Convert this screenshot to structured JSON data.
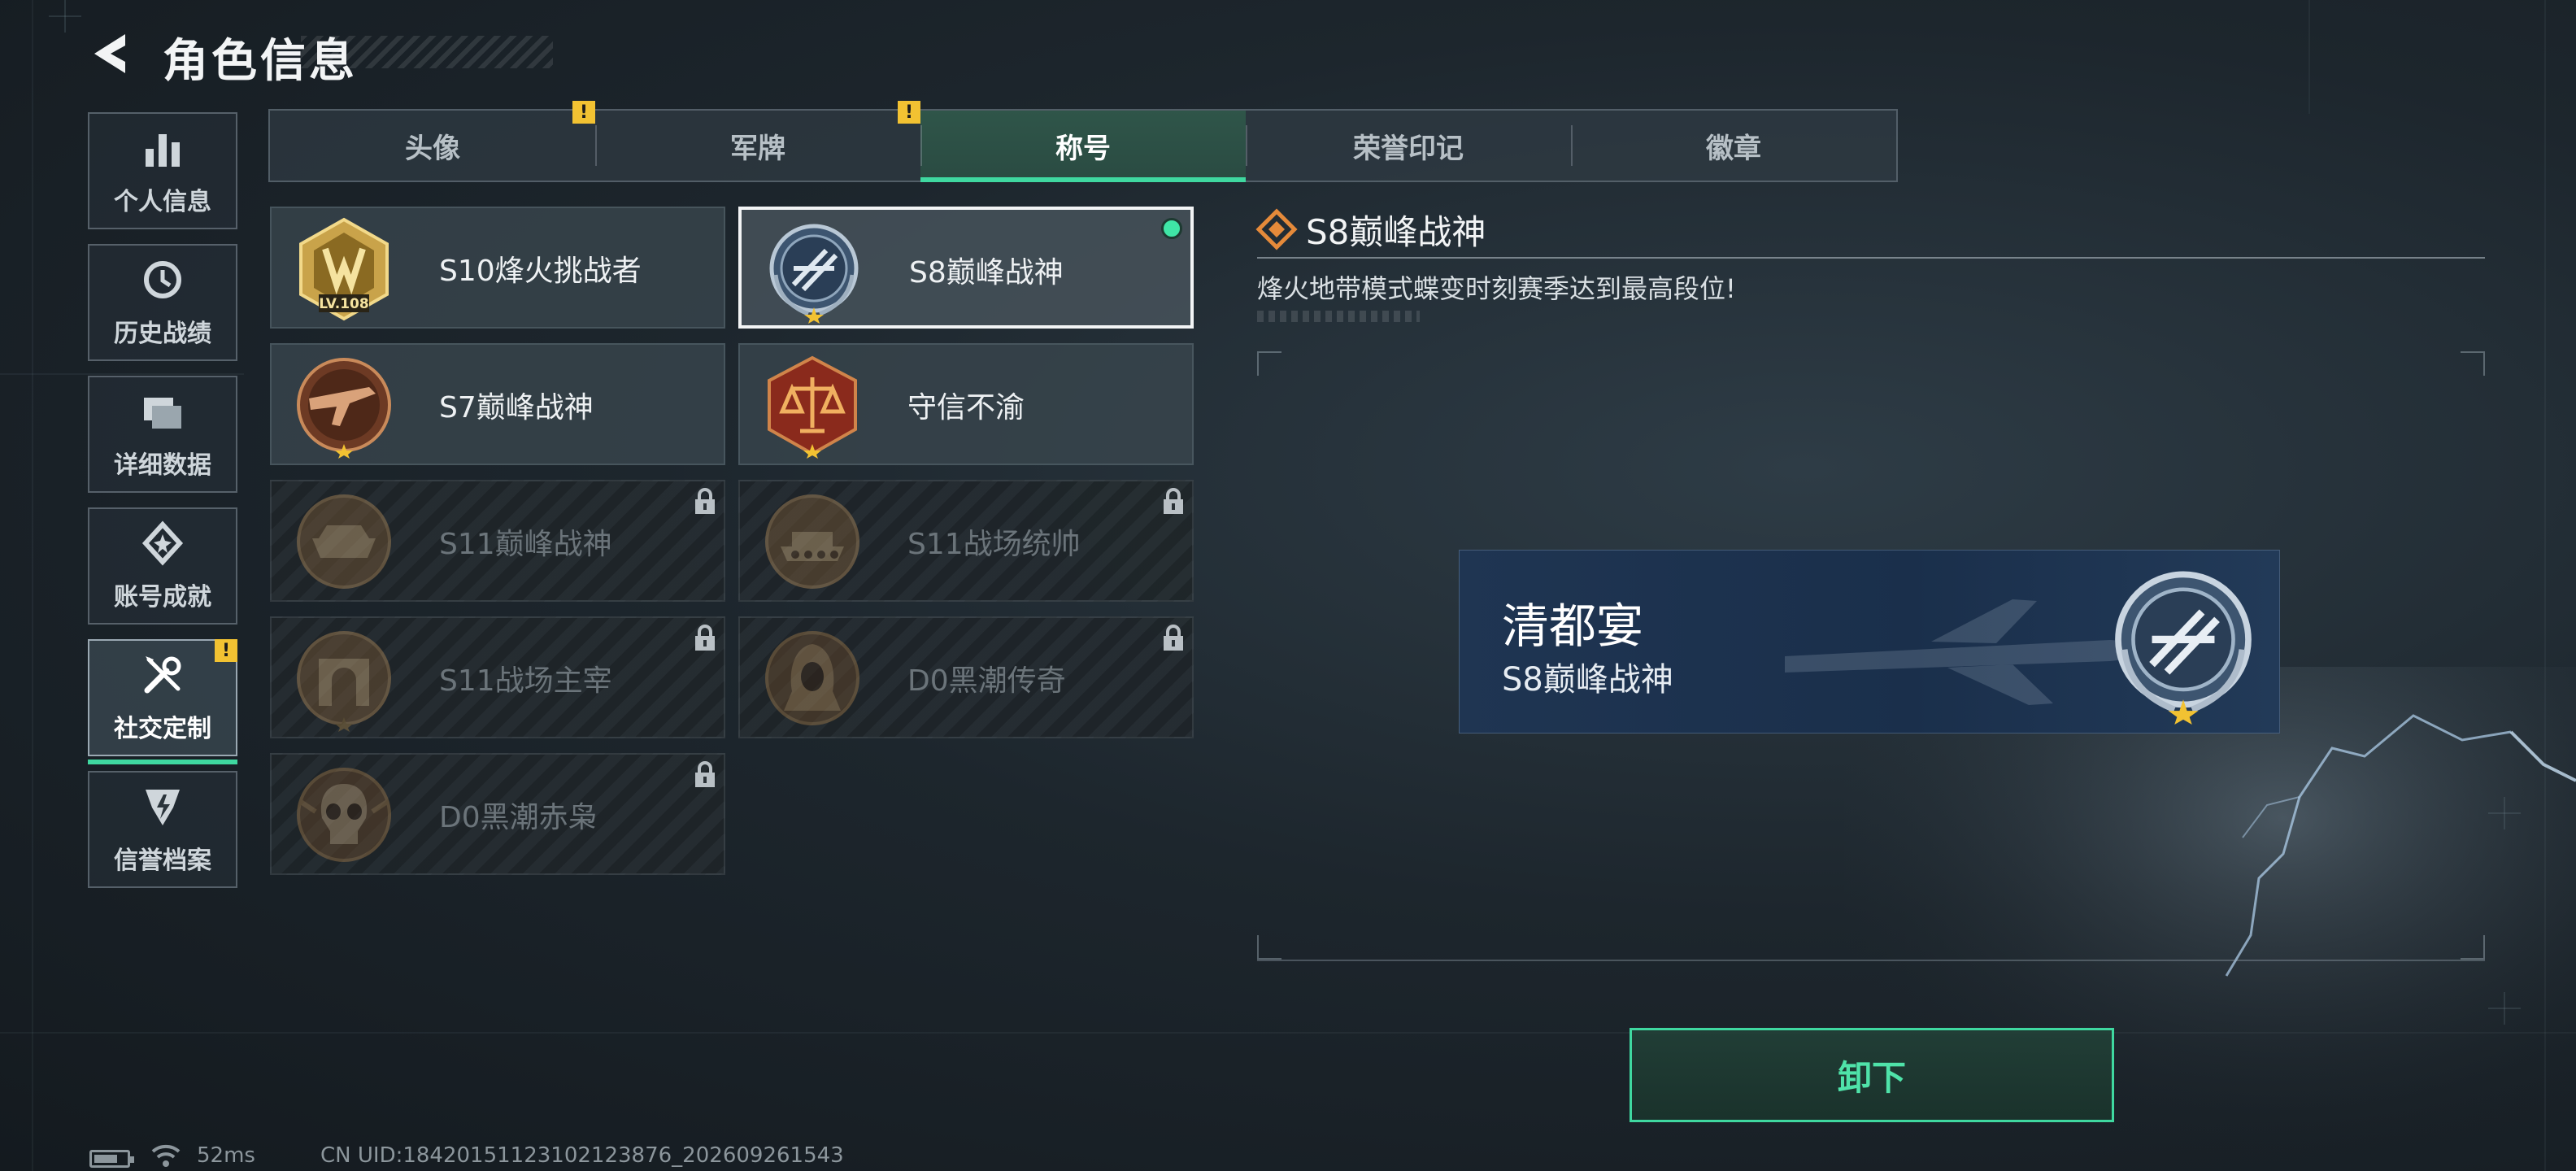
{
  "header": {
    "title": "角色信息",
    "back_icon": "back-arrow-icon"
  },
  "sidebar": {
    "items": [
      {
        "label": "个人信息",
        "icon": "bar-chart-icon",
        "active": false,
        "warning": false
      },
      {
        "label": "历史战绩",
        "icon": "history-clock-icon",
        "active": false,
        "warning": false
      },
      {
        "label": "详细数据",
        "icon": "folders-icon",
        "active": false,
        "warning": false
      },
      {
        "label": "账号成就",
        "icon": "achievement-icon",
        "active": false,
        "warning": false
      },
      {
        "label": "社交定制",
        "icon": "wrench-screwdriver-icon",
        "active": true,
        "warning": true
      },
      {
        "label": "信誉档案",
        "icon": "credit-shield-icon",
        "active": false,
        "warning": false
      }
    ]
  },
  "tabs": [
    {
      "label": "头像",
      "active": false,
      "warning": true
    },
    {
      "label": "军牌",
      "active": false,
      "warning": true
    },
    {
      "label": "称号",
      "active": true,
      "warning": false
    },
    {
      "label": "荣誉印记",
      "active": false,
      "warning": false
    },
    {
      "label": "徽章",
      "active": false,
      "warning": false
    }
  ],
  "titles": [
    {
      "name": "S10烽火挑战者",
      "locked": false,
      "selected": false,
      "equipped": false,
      "medal": "gold-level-108-medal-icon",
      "level_text": "LV.108"
    },
    {
      "name": "S8巅峰战神",
      "locked": false,
      "selected": true,
      "equipped": true,
      "medal": "blue-laurel-medal-icon"
    },
    {
      "name": "S7巅峰战神",
      "locked": false,
      "selected": false,
      "equipped": false,
      "medal": "bronze-weapon-medal-icon"
    },
    {
      "name": "守信不渝",
      "locked": false,
      "selected": false,
      "equipped": false,
      "medal": "scales-medal-icon"
    },
    {
      "name": "S11巅峰战神",
      "locked": true,
      "selected": false,
      "equipped": false,
      "medal": "bronze-vehicle-medal-icon"
    },
    {
      "name": "S11战场统帅",
      "locked": true,
      "selected": false,
      "equipped": false,
      "medal": "bronze-tank-medal-icon"
    },
    {
      "name": "S11战场主宰",
      "locked": true,
      "selected": false,
      "equipped": false,
      "medal": "bronze-arch-medal-icon"
    },
    {
      "name": "D0黑潮传奇",
      "locked": true,
      "selected": false,
      "equipped": false,
      "medal": "hooded-figure-medal-icon"
    },
    {
      "name": "D0黑潮赤枭",
      "locked": true,
      "selected": false,
      "equipped": false,
      "medal": "skull-medal-icon"
    }
  ],
  "detail": {
    "name": "S8巅峰战神",
    "description": "烽火地带模式蝶变时刻赛季达到最高段位!",
    "preview_player": "清都宴",
    "preview_title": "S8巅峰战神",
    "action_label": "卸下"
  },
  "status_bar": {
    "ping": "52ms",
    "uid": "CN UID:1842015112310212387­6_202609261543"
  },
  "colors": {
    "accent_green": "#3fd8a0",
    "warning_yellow": "#f2c232",
    "banner_blue": "#1f3552",
    "detail_orange": "#e58a3a"
  }
}
